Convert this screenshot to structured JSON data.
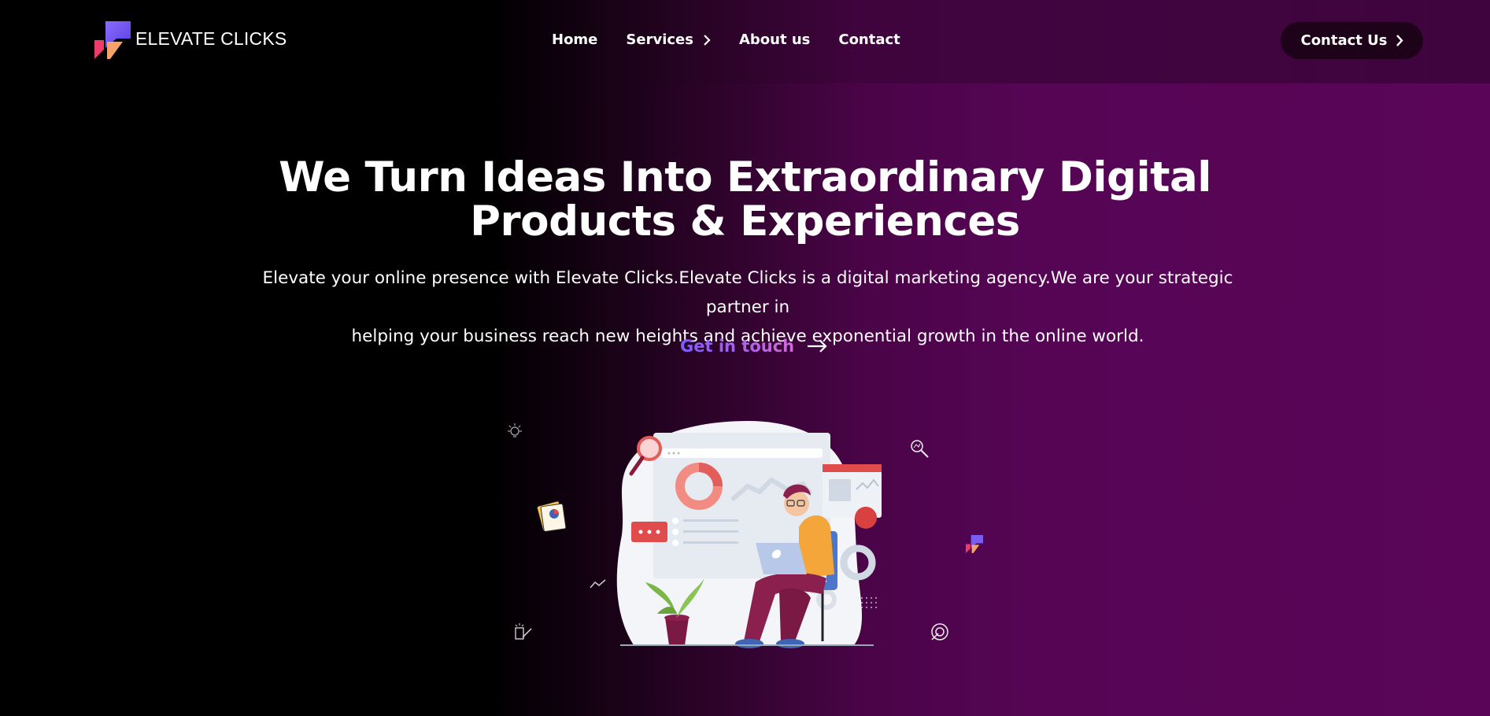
{
  "brand": {
    "name": "ELEVATE CLICKS",
    "icon": "logo-icon"
  },
  "nav": {
    "items": [
      {
        "label": "Home"
      },
      {
        "label": "Services",
        "icon": "chevron-right-icon"
      },
      {
        "label": "About us"
      },
      {
        "label": "Contact"
      }
    ]
  },
  "header_cta": {
    "label": "Contact Us",
    "icon": "chevron-right-icon"
  },
  "hero": {
    "title_line1": "We Turn Ideas Into Extraordinary Digital",
    "title_line2": "Products & Experiences",
    "subtitle_line1": "Elevate your online presence with Elevate Clicks.Elevate Clicks is a digital marketing agency.We are your strategic partner in",
    "subtitle_line2": "helping your business reach new heights and achieve exponential growth in the online world.",
    "cta_label": "Get in touch",
    "cta_icon": "arrow-right-icon"
  },
  "colors": {
    "background_dark": "#000000",
    "background_purple": "#5a0558",
    "button_bg": "#1e0219",
    "cta_gradient_start": "#7c5cff",
    "cta_gradient_end": "#d06ad8"
  }
}
